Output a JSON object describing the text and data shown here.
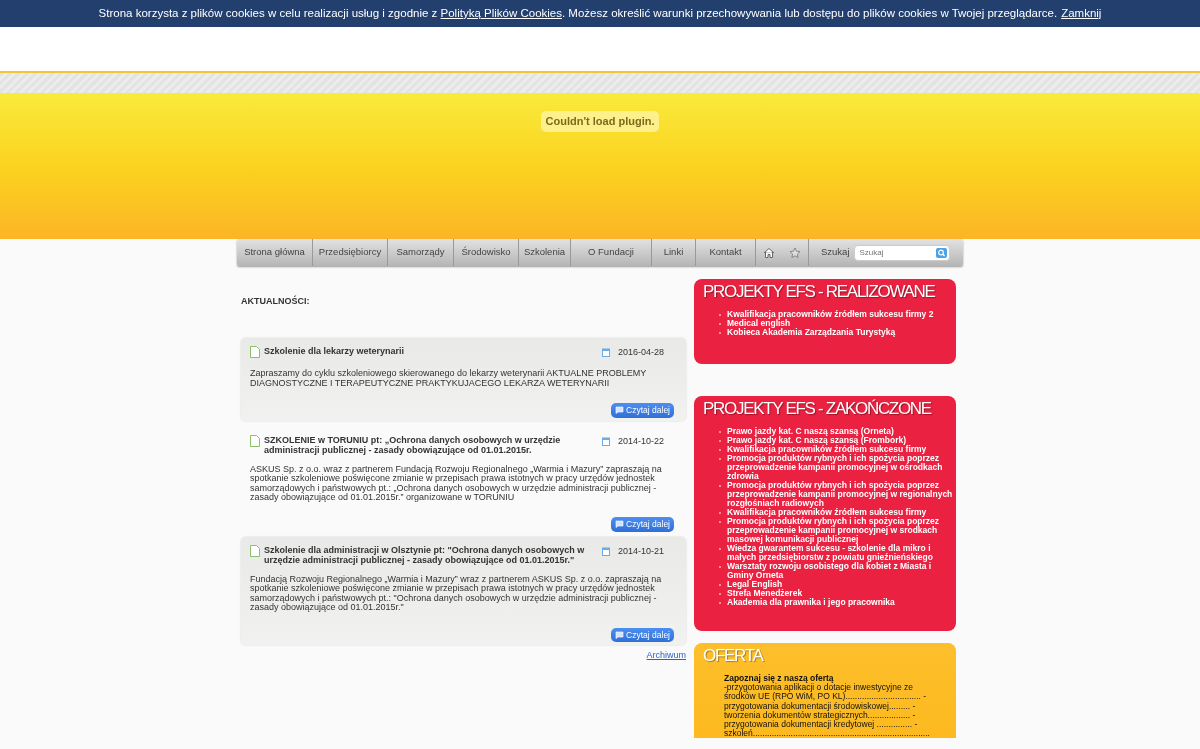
{
  "cookie_bar": {
    "text_before": "Strona korzysta z plików cookies w celu realizacji usług i zgodnie z ",
    "link": "Polityką Plików Cookies",
    "text_after": ". Możesz określić warunki przechowywania lub dostępu do plików cookies w Twojej przeglądarce.",
    "close": "Zamknij"
  },
  "plugin_message": "Couldn't load plugin.",
  "nav": {
    "items": [
      {
        "label": "Strona główna"
      },
      {
        "label": "Przedsiębiorcy"
      },
      {
        "label": "Samorządy"
      },
      {
        "label": "Środowisko"
      },
      {
        "label": "Szkolenia"
      },
      {
        "label": "O Fundacji"
      },
      {
        "label": "Linki"
      },
      {
        "label": "Kontakt"
      }
    ],
    "icons": [
      {
        "kind": "home"
      },
      {
        "kind": "star"
      }
    ],
    "search_label": "Szukaj",
    "search": {
      "placeholder": "Szukaj"
    }
  },
  "news": {
    "heading": "AKTUALNOŚCI:",
    "items": [
      {
        "title": "Szkolenie dla lekarzy weterynarii",
        "date": "2016-04-28",
        "text": "Zapraszamy do cyklu szkoleniowego skierowanego do lekarzy weterynarii AKTUALNE PROBLEMY DIAGNOSTYCZNE I TERAPEUTYCZNE PRAKTYKUJACEGO LEKARZA WETERYNARII",
        "button": "Czytaj dalej",
        "shaded": true
      },
      {
        "title": "SZKOLENIE w TORUNIU pt: „Ochrona danych osobowych w urzędzie administracji publicznej - zasady obowiązujące od 01.01.2015r.",
        "date": "2014-10-22",
        "text": "ASKUS Sp. z o.o. wraz z partnerem Fundacją Rozwoju Regionalnego „Warmia i Mazury” zapraszają na spotkanie szkoleniowe poświęcone zmianie w przepisach prawa istotnych w pracy urzędów jednostek samorządowych i państwowych pt.: „Ochrona danych osobowych w urzędzie administracji publicznej - zasady obowiązujące od 01.01.2015r.” organizowane w TORUNIU",
        "button": "Czytaj dalej",
        "shaded": false
      },
      {
        "title": "Szkolenie dla administracji w Olsztynie pt: \"Ochrona danych osobowych w urzędzie administracji publicznej - zasady obowiązujące od 01.01.2015r.\"",
        "date": "2014-10-21",
        "text": "Fundacją Rozwoju Regionalnego „Warmia i Mazury” wraz z partnerem ASKUS Sp. z o.o. zapraszają na spotkanie szkoleniowe poświęcone zmianie w przepisach prawa istotnych w pracy urzędów jednostek samorządowych i państwowych pt.: \"Ochrona danych osobowych w urzędzie administracji publicznej - zasady obowiązujące od 01.01.2015r.\"",
        "button": "Czytaj dalej",
        "shaded": true
      }
    ],
    "archive_link": "Archiwum"
  },
  "panels": [
    {
      "kind": "red",
      "title": "PROJEKTY EFS - REALIZOWANE",
      "items": [
        "Kwalifikacja pracowników źródłem sukcesu firmy 2",
        "Medical english",
        "Kobieca Akademia Zarządzania Turystyką"
      ]
    },
    {
      "kind": "red",
      "title": "PROJEKTY EFS - ZAKOŃCZONE",
      "items": [
        "Prawo jazdy kat. C naszą szansą (Orneta)",
        "Prawo jazdy kat. C naszą szansą (Frombork)",
        "Kwalifikacja pracowników źródłem sukcesu firmy",
        "Promocja produktów rybnych i ich spożycia poprzez przeprowadzenie kampanii promocyjnej w ośrodkach zdrowia",
        "Promocja produktów rybnych i ich spożycia poprzez przeprowadzenie kampanii promocyjnej w regionalnych rozgłośniach radiowych",
        "Kwalifikacja pracowników źródłem sukcesu firmy",
        "Promocja produktów rybnych i ich spożycia poprzez przeprowadzenie kampanii promocyjnej w srodkach masowej komunikacji publicznej",
        "Wiedza gwarantem sukcesu - szkolenie dla mikro i małych przedsiębiorstw z powiatu gnieźnieńskiego",
        "Warsztaty rozwoju osobistego dla kobiet z Miasta i Gminy Orneta",
        "Legal English",
        "Strefa Menedżerek",
        "Akademia dla prawnika i jego pracownika"
      ]
    },
    {
      "kind": "offer",
      "title": "OFERTA",
      "intro": "Zapoznaj się z naszą ofertą",
      "lines": [
        "-przygotowania aplikacji o dotacje inwestycyjne ze",
        "środków UE (RPO WiM, PO KL)................................ -",
        "przygotowania dokumentacji środowiskowej......... -",
        "tworzenia dokumentów strategicznych.................. -",
        "przygotowania dokumentacji kredytowej ............... -",
        "szkoleń..........................................................................."
      ]
    }
  ]
}
